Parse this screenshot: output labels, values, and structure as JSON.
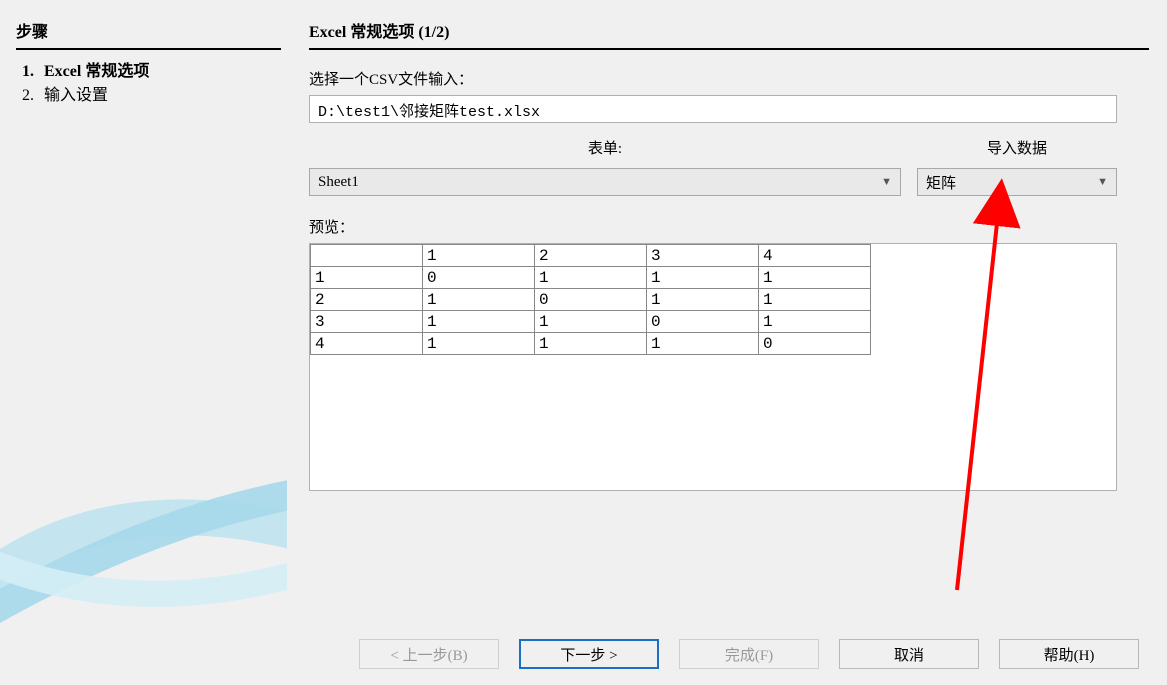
{
  "sidebar": {
    "title": "步骤",
    "items": [
      {
        "num": "1.",
        "label": "Excel 常规选项",
        "active": true
      },
      {
        "num": "2.",
        "label": "输入设置",
        "active": false
      }
    ]
  },
  "main": {
    "title": "Excel 常规选项 (1/2)",
    "file_label": "选择一个CSV文件输入：",
    "file_value": "D:\\test1\\邻接矩阵test.xlsx",
    "sheet_label": "表单:",
    "sheet_value": "Sheet1",
    "import_label": "导入数据",
    "import_value": "矩阵",
    "preview_label": "预览：",
    "preview_table": [
      [
        "",
        "1",
        "2",
        "3",
        "4"
      ],
      [
        "1",
        "0",
        "1",
        "1",
        "1"
      ],
      [
        "2",
        "1",
        "0",
        "1",
        "1"
      ],
      [
        "3",
        "1",
        "1",
        "0",
        "1"
      ],
      [
        "4",
        "1",
        "1",
        "1",
        "0"
      ]
    ]
  },
  "buttons": {
    "back": "< 上一步(B)",
    "next": "下一步 >",
    "finish": "完成(F)",
    "cancel": "取消",
    "help": "帮助(H)"
  }
}
